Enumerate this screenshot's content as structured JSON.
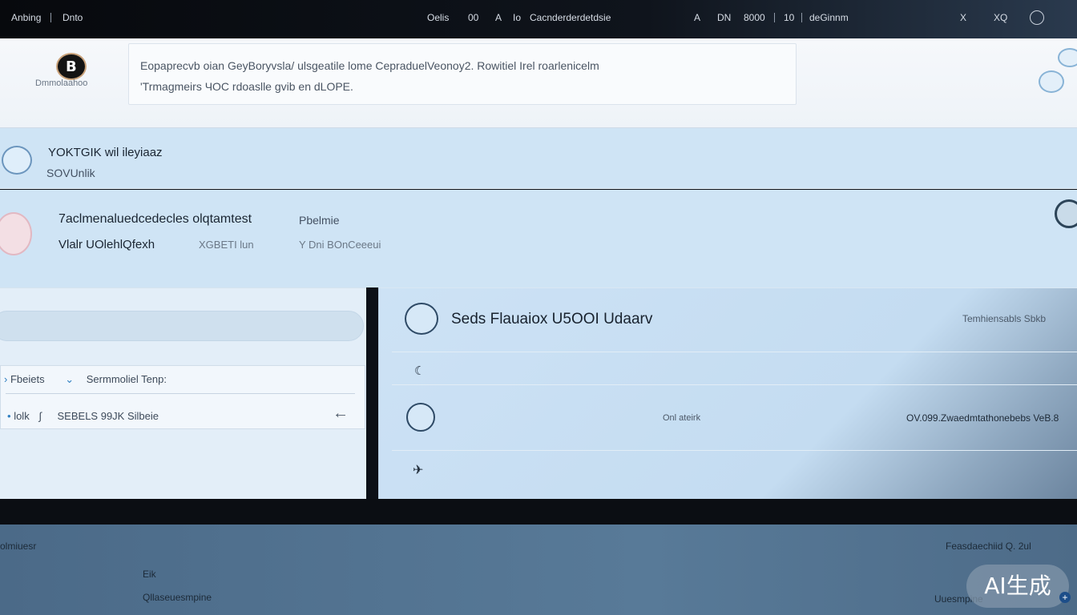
{
  "topbar": {
    "left_items": [
      "Anbing",
      "Dnto"
    ],
    "center_items": [
      "Oelis",
      "00",
      "A",
      "Io",
      "Cacnderderdetdsie"
    ],
    "right_items": [
      "A",
      "DN",
      "8000",
      "10",
      "deGinnm",
      "X",
      "XQ"
    ]
  },
  "header": {
    "logo_text": "Dmmolaahoo",
    "notice_line1": "Eopaprecvb oian GeyBoryvsla/ ulsgeatile lome CepraduelVeonoy2.   Rowitiel Irel roarlenicelm",
    "notice_line2": "'Trmagmeirs ЧOC rdoaslle gvib en dLOPE."
  },
  "section1": {
    "title": "YOKTGIK wil ileyiaaz",
    "subtitle": "SOVUnlik"
  },
  "section2": {
    "title": "7aclmenaluedcedecles olqtamtest",
    "tag": "Pbelmie",
    "line_a": "Vlalr UOlehlQfexh",
    "line_b": "XGBETI lun",
    "line_c": "Y Dni BOnCeeeui"
  },
  "left_panel": {
    "filter_label": "Fbeiets",
    "filter_text": "Sermmoliel Tenp:",
    "row_label": "lolk",
    "row_text": "SEBELS 99JK Silbeie"
  },
  "right_panel": {
    "title": "Seds Flauaiox U5OOI Udaarv",
    "header_right": "Temhiensabls Sbkb",
    "row2_mid": "Onl ateirk",
    "row2_right": "OV.099.Zwaedmtathonebebs VeB.8"
  },
  "footer": {
    "left_text": "olmiuesr",
    "item1": "Eik",
    "item2": "Qllaseuesmpine",
    "right1": "Feasdaechiid Q. 2ul",
    "right2": "Uuesmpine",
    "badge": "AI生成"
  }
}
